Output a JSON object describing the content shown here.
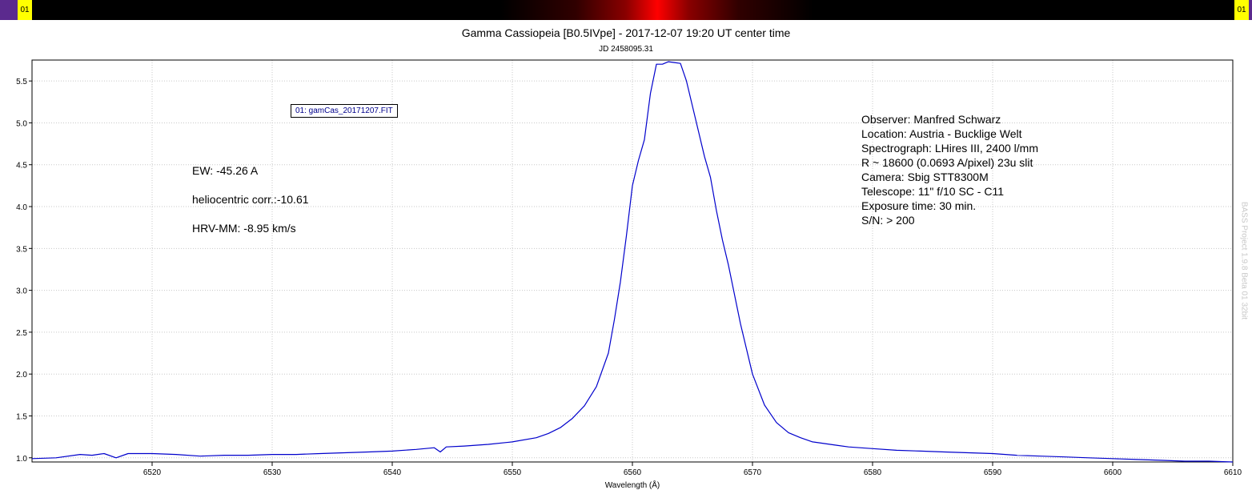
{
  "header": {
    "left_tag": "01",
    "right_tag": "01",
    "title": "Gamma Cassiopeia [B0.5IVpe] - 2017-12-07 19:20 UT center time",
    "subtitle": "JD 2458095.31",
    "legend": "01: gamCas_20171207.FIT",
    "watermark": "BASS Project 1.9.8 Beta 01 32bit"
  },
  "notes": {
    "ew": "EW: -45.26 A",
    "helio": "heliocentric corr.:-10.61",
    "hrv": "HRV-MM: -8.95 km/s"
  },
  "observer": {
    "lines": [
      "Observer: Manfred Schwarz",
      "Location: Austria - Bucklige Welt",
      "Spectrograph: LHires III, 2400 l/mm",
      "R ~ 18600 (0.0693 A/pixel) 23u slit",
      "Camera: Sbig STT8300M",
      "Telescope: 11\" f/10 SC - C11",
      "Exposure time: 30 min.",
      "S/N:  > 200"
    ]
  },
  "colors": {
    "series": "#0000cc",
    "grid": "#c8c8c8",
    "axis": "#000000"
  },
  "chart_data": {
    "type": "line",
    "title": "Gamma Cassiopeia [B0.5IVpe] - 2017-12-07 19:20 UT center time",
    "subtitle": "JD 2458095.31",
    "xlabel": "Wavelength (Å)",
    "ylabel": "",
    "xlim": [
      6510,
      6610
    ],
    "ylim": [
      0.95,
      5.75
    ],
    "xticks": [
      6520,
      6530,
      6540,
      6550,
      6560,
      6570,
      6580,
      6590,
      6600,
      6610
    ],
    "xtick_labels": [
      "6520",
      "6530",
      "6540",
      "6550",
      "6560",
      "6570",
      "6580",
      "6590",
      "6600",
      "6610"
    ],
    "yticks": [
      1.0,
      1.5,
      2.0,
      2.5,
      3.0,
      3.5,
      4.0,
      4.5,
      5.0,
      5.5
    ],
    "ytick_labels": [
      "1.0",
      "1.5",
      "2.0",
      "2.5",
      "3.0",
      "3.5",
      "4.0",
      "4.5",
      "5.0",
      "5.5"
    ],
    "grid": "dotted",
    "series": [
      {
        "name": "01: gamCas_20171207.FIT",
        "x": [
          6510,
          6512,
          6514,
          6515,
          6516,
          6517,
          6518,
          6520,
          6522,
          6524,
          6526,
          6528,
          6530,
          6532,
          6534,
          6536,
          6538,
          6540,
          6542,
          6543.5,
          6544,
          6544.5,
          6546,
          6548,
          6550,
          6552,
          6553,
          6554,
          6555,
          6556,
          6557,
          6558,
          6558.5,
          6559,
          6559.5,
          6560,
          6560.5,
          6561,
          6561.5,
          6562,
          6562.5,
          6563,
          6563.5,
          6564,
          6564.5,
          6565,
          6565.5,
          6566,
          6566.5,
          6567,
          6567.5,
          6568,
          6569,
          6570,
          6571,
          6572,
          6573,
          6574,
          6575,
          6576,
          6577,
          6578,
          6580,
          6582,
          6584,
          6586,
          6588,
          6590,
          6592,
          6594,
          6596,
          6598,
          6600,
          6602,
          6604,
          6606,
          6608,
          6610
        ],
        "y": [
          0.99,
          1.0,
          1.04,
          1.03,
          1.05,
          1.0,
          1.05,
          1.05,
          1.04,
          1.02,
          1.03,
          1.03,
          1.04,
          1.04,
          1.05,
          1.06,
          1.07,
          1.08,
          1.1,
          1.12,
          1.07,
          1.13,
          1.14,
          1.16,
          1.19,
          1.24,
          1.29,
          1.36,
          1.47,
          1.62,
          1.85,
          2.25,
          2.65,
          3.1,
          3.65,
          4.25,
          4.55,
          4.8,
          5.35,
          5.7,
          5.7,
          5.73,
          5.72,
          5.71,
          5.5,
          5.2,
          4.9,
          4.6,
          4.35,
          3.95,
          3.6,
          3.3,
          2.6,
          2.0,
          1.63,
          1.42,
          1.3,
          1.24,
          1.19,
          1.17,
          1.15,
          1.13,
          1.11,
          1.09,
          1.08,
          1.07,
          1.06,
          1.05,
          1.03,
          1.02,
          1.01,
          1.0,
          0.99,
          0.98,
          0.97,
          0.96,
          0.96,
          0.95
        ]
      }
    ]
  }
}
